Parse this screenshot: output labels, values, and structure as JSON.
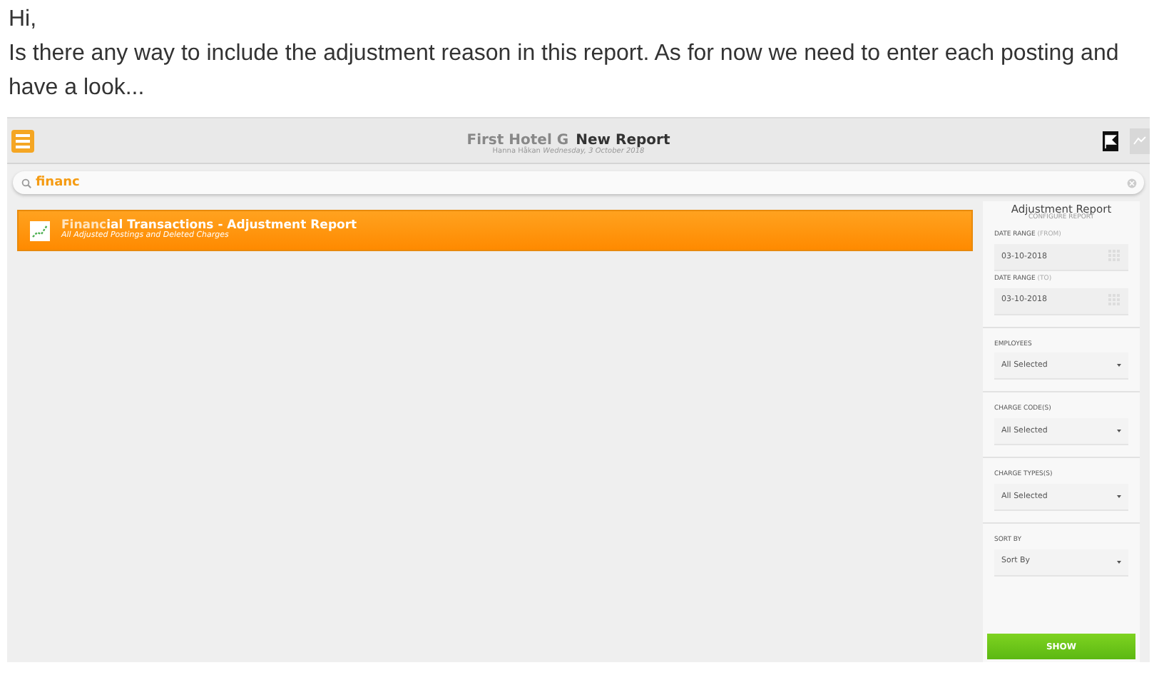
{
  "post": {
    "greeting": "Hi,",
    "body": "Is there any way to include the adjustment reason in this report. As for now we need to enter each posting and have a look..."
  },
  "app": {
    "hotel": "First Hotel G",
    "title": "New Report",
    "user": "Hanna Håkan",
    "date": "Wednesday, 3 October 2018"
  },
  "search": {
    "value": "financ"
  },
  "results": [
    {
      "match": "Financ",
      "rest": "ial Transactions - Adjustment Report",
      "subtitle": "All Adjusted Postings and Deleted Charges"
    }
  ],
  "panel": {
    "title": "Adjustment Report",
    "subtitle": "CONFIGURE REPORT",
    "fields": [
      {
        "kind": "date",
        "label": "DATE RANGE",
        "hint": "(FROM)",
        "value": "03-10-2018"
      },
      {
        "kind": "date",
        "label": "DATE RANGE",
        "hint": "(TO)",
        "value": "03-10-2018"
      },
      {
        "kind": "select",
        "label": "EMPLOYEES",
        "value": "All Selected"
      },
      {
        "kind": "select",
        "label": "CHARGE CODE(S)",
        "value": "All Selected"
      },
      {
        "kind": "select",
        "label": "CHARGE TYPES(S)",
        "value": "All Selected"
      },
      {
        "kind": "select",
        "label": "SORT BY",
        "value": "Sort By"
      }
    ],
    "button": "SHOW"
  }
}
